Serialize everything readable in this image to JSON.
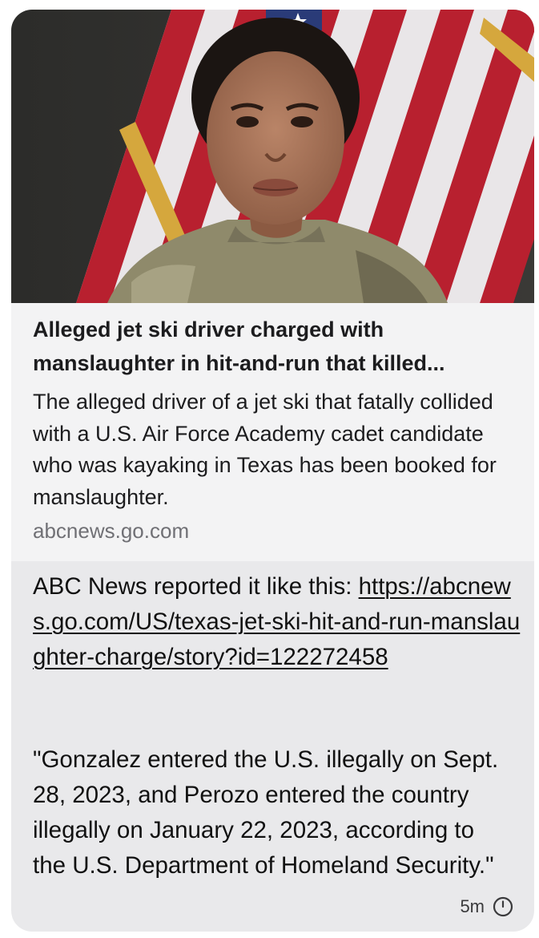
{
  "link_preview": {
    "image_alt": "Portrait of a uniformed service member in front of an American flag",
    "title": "Alleged jet ski driver charged with manslaughter in hit-and-run that killed...",
    "description": "The alleged driver of a jet ski that fatally collided with a U.S. Air Force Academy cadet candidate who was kayaking in Texas has been booked for manslaughter.",
    "domain": "abcnews.go.com"
  },
  "message": {
    "intro": "ABC News reported it like this: ",
    "link": "https://abcnews.go.com/US/texas-jet-ski-hit-and-run-manslaughter-charge/story?id=122272458",
    "quote": "\"Gonzalez entered the U.S. illegally on Sept. 28, 2023, and Perozo entered the country illegally on January 22, 2023, according to the U.S. Department of Homeland Security.\"",
    "timestamp": "5m",
    "status_icon": "clock-icon"
  },
  "colors": {
    "bubble_bg": "#e9e9eb",
    "preview_bg": "#f3f3f4",
    "text": "#1c1c1e",
    "muted": "#707075"
  }
}
